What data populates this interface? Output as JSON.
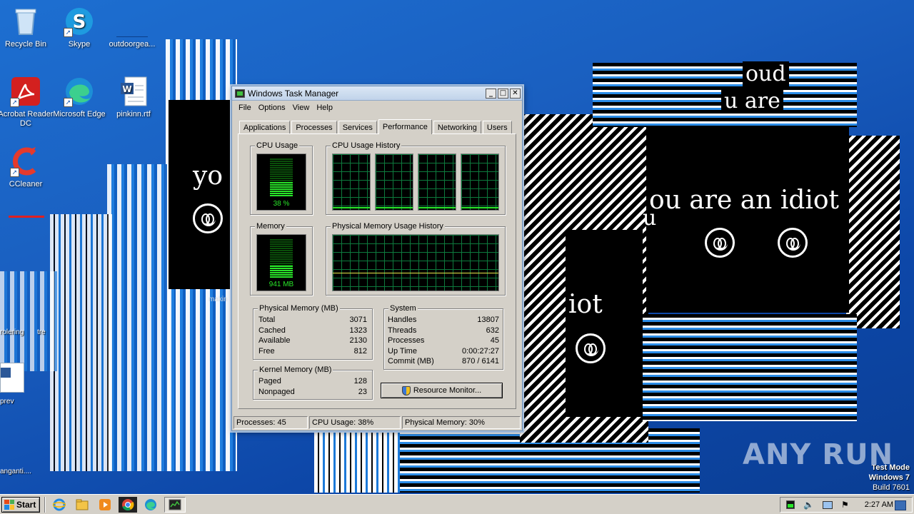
{
  "desktop": {
    "icons": [
      {
        "label": "Recycle Bin",
        "icon": "recycle-bin-icon"
      },
      {
        "label": "Skype",
        "icon": "skype-icon"
      },
      {
        "label": "outdoorgea...",
        "icon": "document-icon"
      },
      {
        "label": "Acrobat Reader DC",
        "icon": "acrobat-icon"
      },
      {
        "label": "Microsoft Edge",
        "icon": "edge-icon"
      },
      {
        "label": "pinkinn.rtf",
        "icon": "word-document-icon"
      },
      {
        "label": "CCleaner",
        "icon": "ccleaner-icon"
      }
    ],
    "partial_labels": [
      "rolering",
      "tre",
      "prev",
      "makin",
      "anganti...."
    ],
    "idiot_texts": {
      "left": "yo",
      "right": "ou are an idiot",
      "middle": "iot",
      "garbled": "u",
      "top_garbled_1": "oud",
      "top_garbled_2": "u are"
    }
  },
  "task_manager": {
    "title": "Windows Task Manager",
    "menu": [
      "File",
      "Options",
      "View",
      "Help"
    ],
    "tabs": [
      "Applications",
      "Processes",
      "Services",
      "Performance",
      "Networking",
      "Users"
    ],
    "active_tab": "Performance",
    "cpu_usage": {
      "label": "CPU Usage",
      "value_text": "38 %",
      "percent": 38
    },
    "cpu_history": {
      "label": "CPU Usage History"
    },
    "memory": {
      "label": "Memory",
      "value_text": "941 MB",
      "percent": 31
    },
    "memory_history": {
      "label": "Physical Memory Usage History"
    },
    "physical_memory": {
      "label": "Physical Memory (MB)",
      "rows": [
        {
          "name": "Total",
          "value": "3071"
        },
        {
          "name": "Cached",
          "value": "1323"
        },
        {
          "name": "Available",
          "value": "2130"
        },
        {
          "name": "Free",
          "value": "812"
        }
      ]
    },
    "kernel_memory": {
      "label": "Kernel Memory (MB)",
      "rows": [
        {
          "name": "Paged",
          "value": "128"
        },
        {
          "name": "Nonpaged",
          "value": "23"
        }
      ]
    },
    "system": {
      "label": "System",
      "rows": [
        {
          "name": "Handles",
          "value": "13807"
        },
        {
          "name": "Threads",
          "value": "632"
        },
        {
          "name": "Processes",
          "value": "45"
        },
        {
          "name": "Up Time",
          "value": "0:00:27:27"
        },
        {
          "name": "Commit (MB)",
          "value": "870 / 6141"
        }
      ]
    },
    "resource_monitor_button": "Resource Monitor...",
    "status": {
      "processes": "Processes: 45",
      "cpu": "CPU Usage: 38%",
      "memory": "Physical Memory: 30%"
    }
  },
  "taskbar": {
    "start_label": "Start",
    "clock": "2:27 AM"
  },
  "watermark": "ANY RUN",
  "test_mode": {
    "line1": "Test Mode",
    "line2": "Windows 7",
    "line3": "Build 7601"
  },
  "colors": {
    "graph_green": "#29e629",
    "desktop_blue": "#1a5fc0",
    "window_face": "#d4d0c8"
  }
}
